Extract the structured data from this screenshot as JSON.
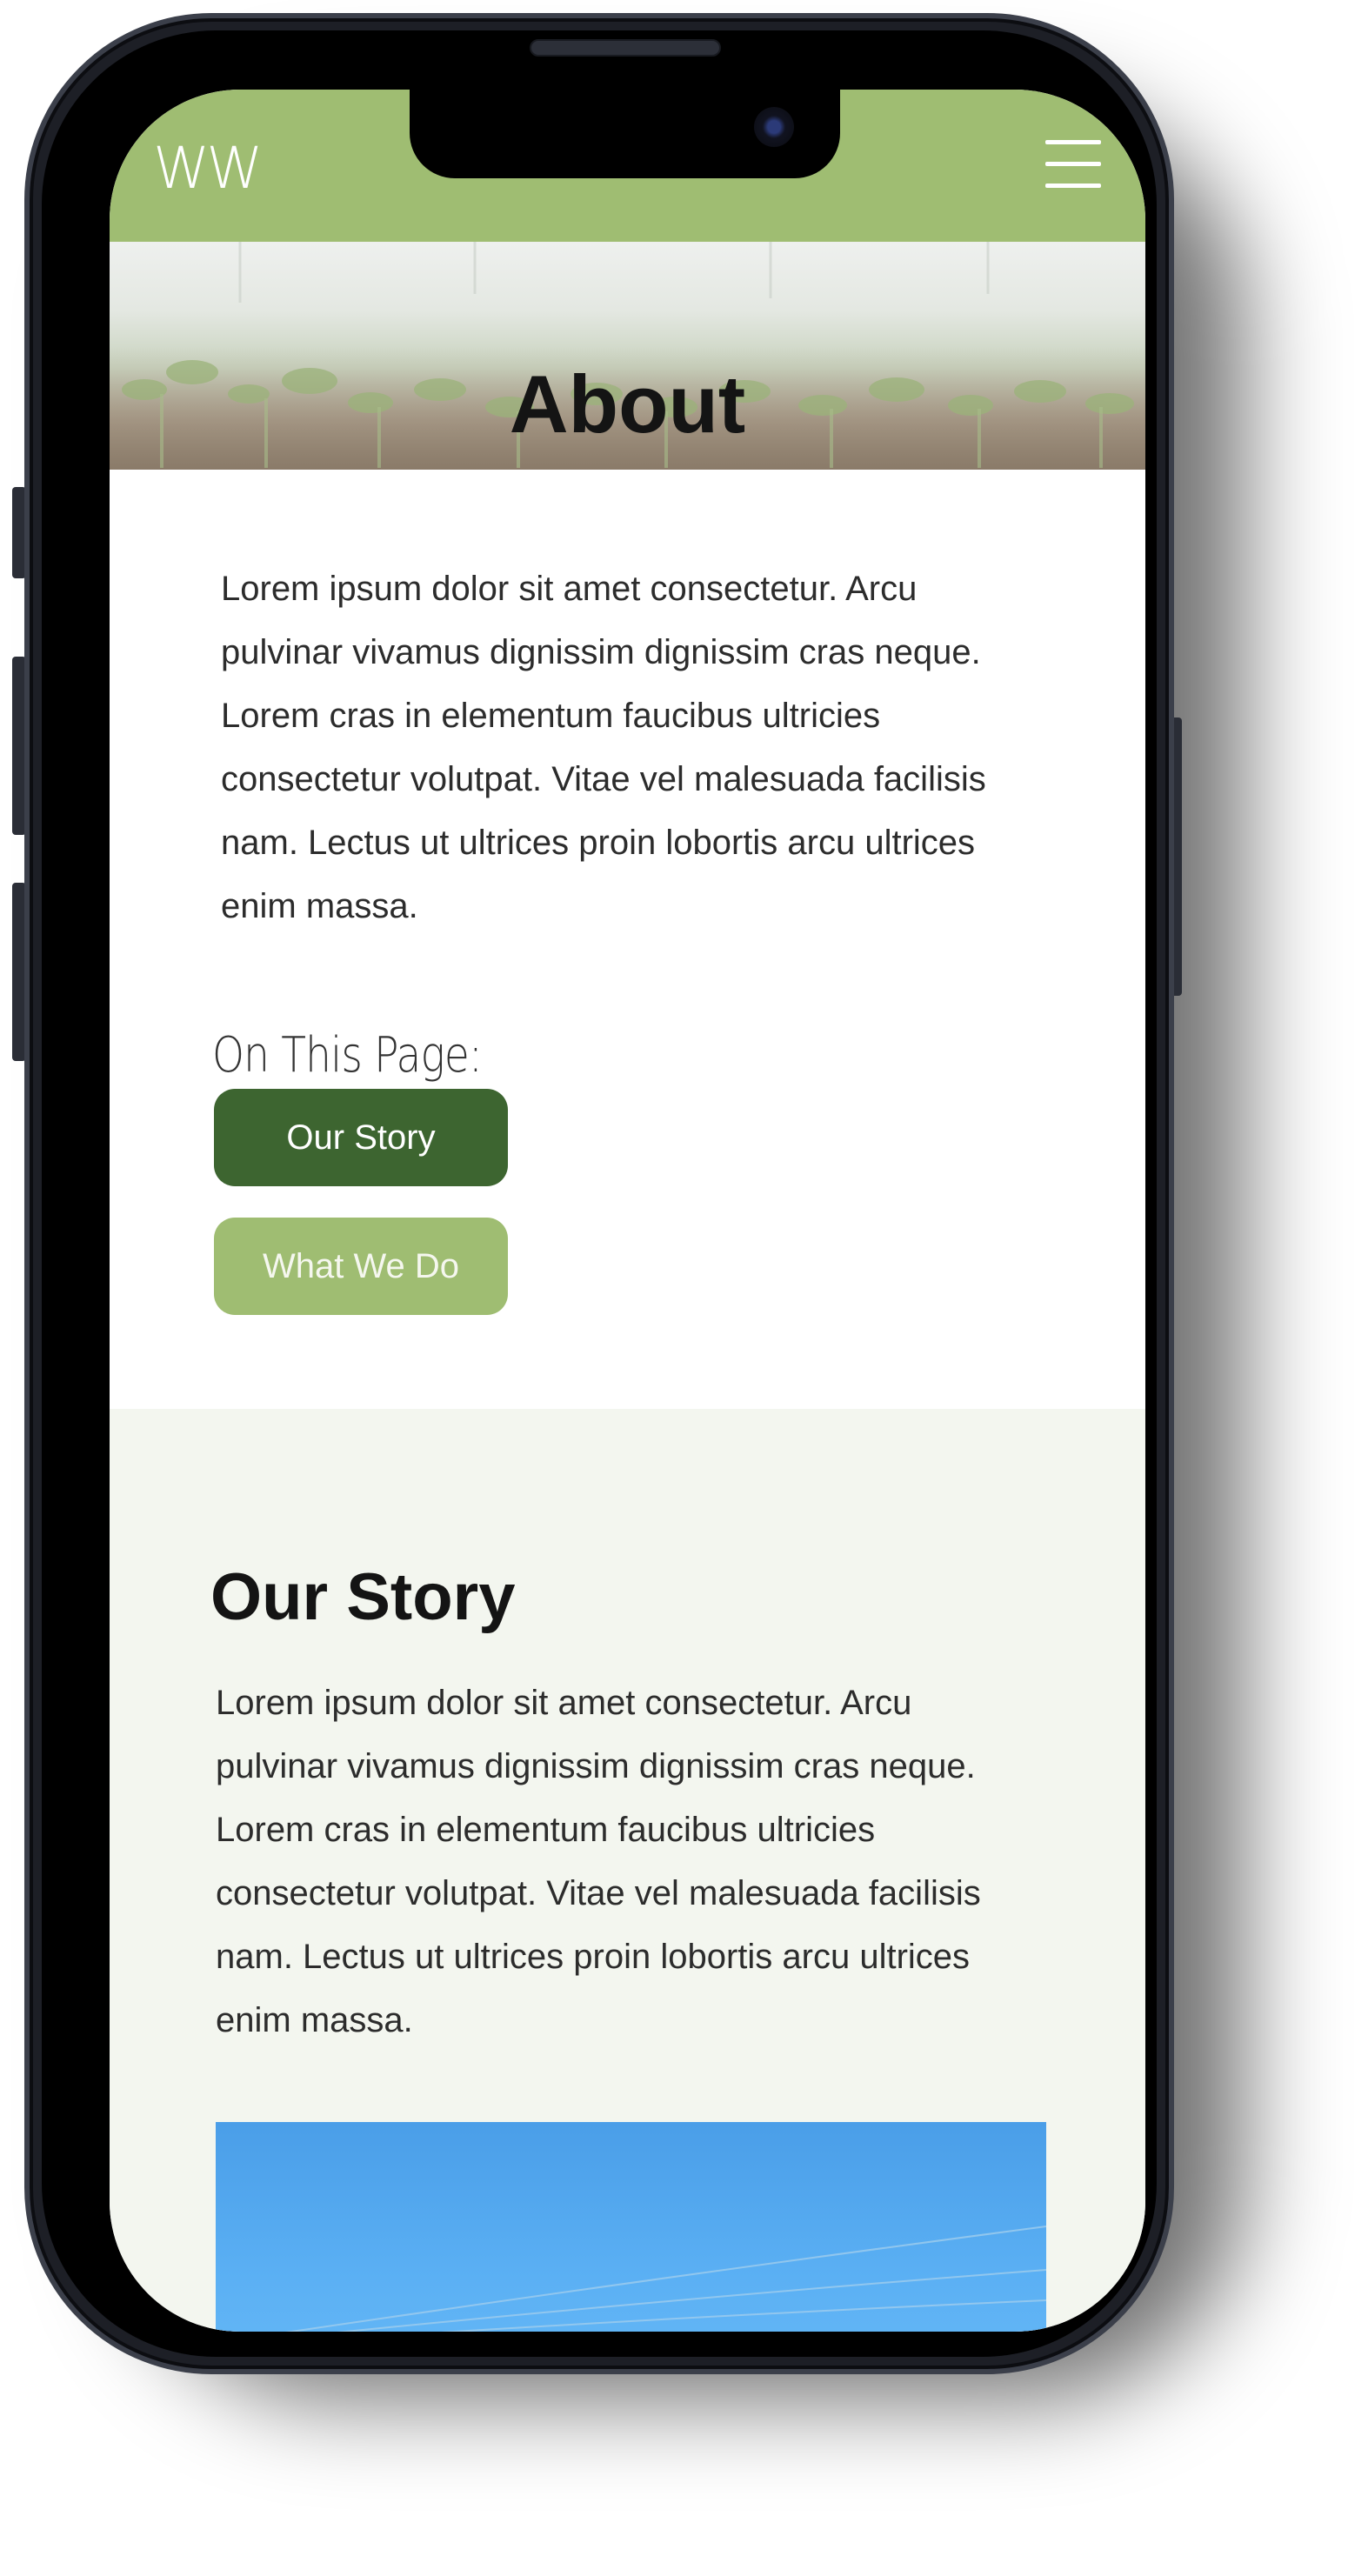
{
  "site": {
    "logo": "WW",
    "header_color": "#9fbd72"
  },
  "icons": {
    "menu": "hamburger-menu-icon",
    "camera": "front-camera"
  },
  "hero": {
    "title": "About"
  },
  "intro": {
    "text": "Lorem ipsum dolor sit amet consectetur. Arcu pulvinar vivamus dignissim dignissim cras neque. Lorem cras in elementum faucibus ultricies consectetur volutpat. Vitae vel malesuada facilisis nam. Lectus ut ultrices proin lobortis arcu ultrices enim massa."
  },
  "on_this_page": {
    "heading": "On This Page:",
    "links": [
      {
        "label": "Our Story",
        "color": "#3d6530"
      },
      {
        "label": "What We Do",
        "color": "#9fbd72"
      }
    ]
  },
  "our_story": {
    "heading": "Our Story",
    "text": "Lorem ipsum dolor sit amet consectetur. Arcu pulvinar vivamus dignissim dignissim cras neque. Lorem cras in elementum faucibus ultricies consectetur volutpat. Vitae vel malesuada facilisis nam. Lectus ut ultrices proin lobortis arcu ultrices enim massa.",
    "background": "#f3f6ef"
  }
}
